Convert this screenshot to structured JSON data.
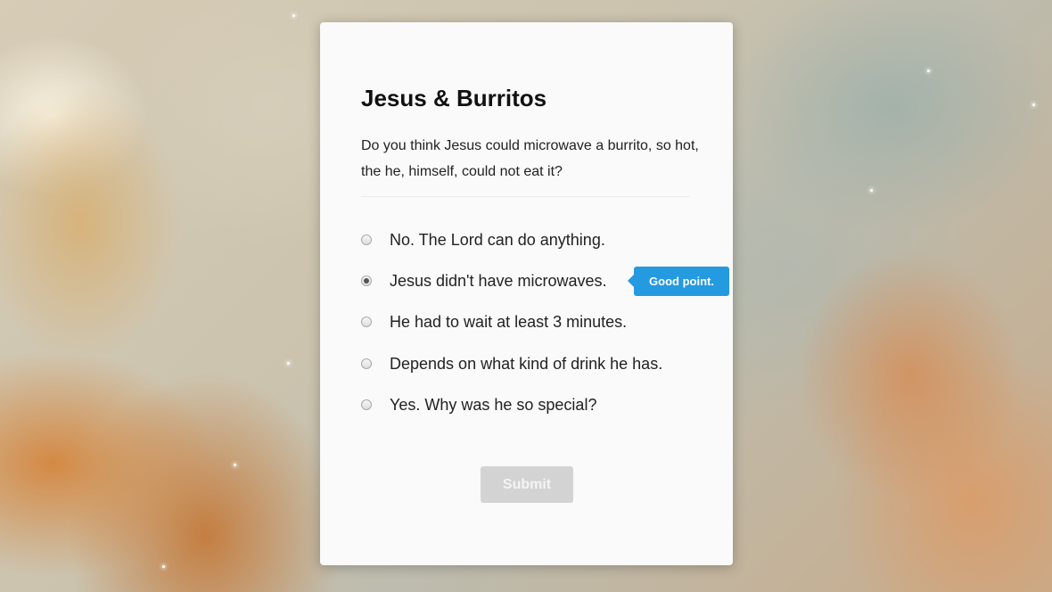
{
  "quiz": {
    "title": "Jesus & Burritos",
    "question": "Do you think Jesus could microwave a burrito, so hot, the he, himself, could not eat it?",
    "options": [
      {
        "label": "No. The Lord can do anything.",
        "selected": false
      },
      {
        "label": "Jesus didn't have microwaves.",
        "selected": true
      },
      {
        "label": "He had to wait at least 3 minutes.",
        "selected": false
      },
      {
        "label": "Depends on what kind of drink he has.",
        "selected": false
      },
      {
        "label": "Yes. Why was he so special?",
        "selected": false
      }
    ],
    "feedback": "Good point.",
    "submit_label": "Submit"
  },
  "colors": {
    "card_background": "#fafafa",
    "tooltip_background": "#249ae0",
    "submit_disabled": "#d3d3d3"
  }
}
